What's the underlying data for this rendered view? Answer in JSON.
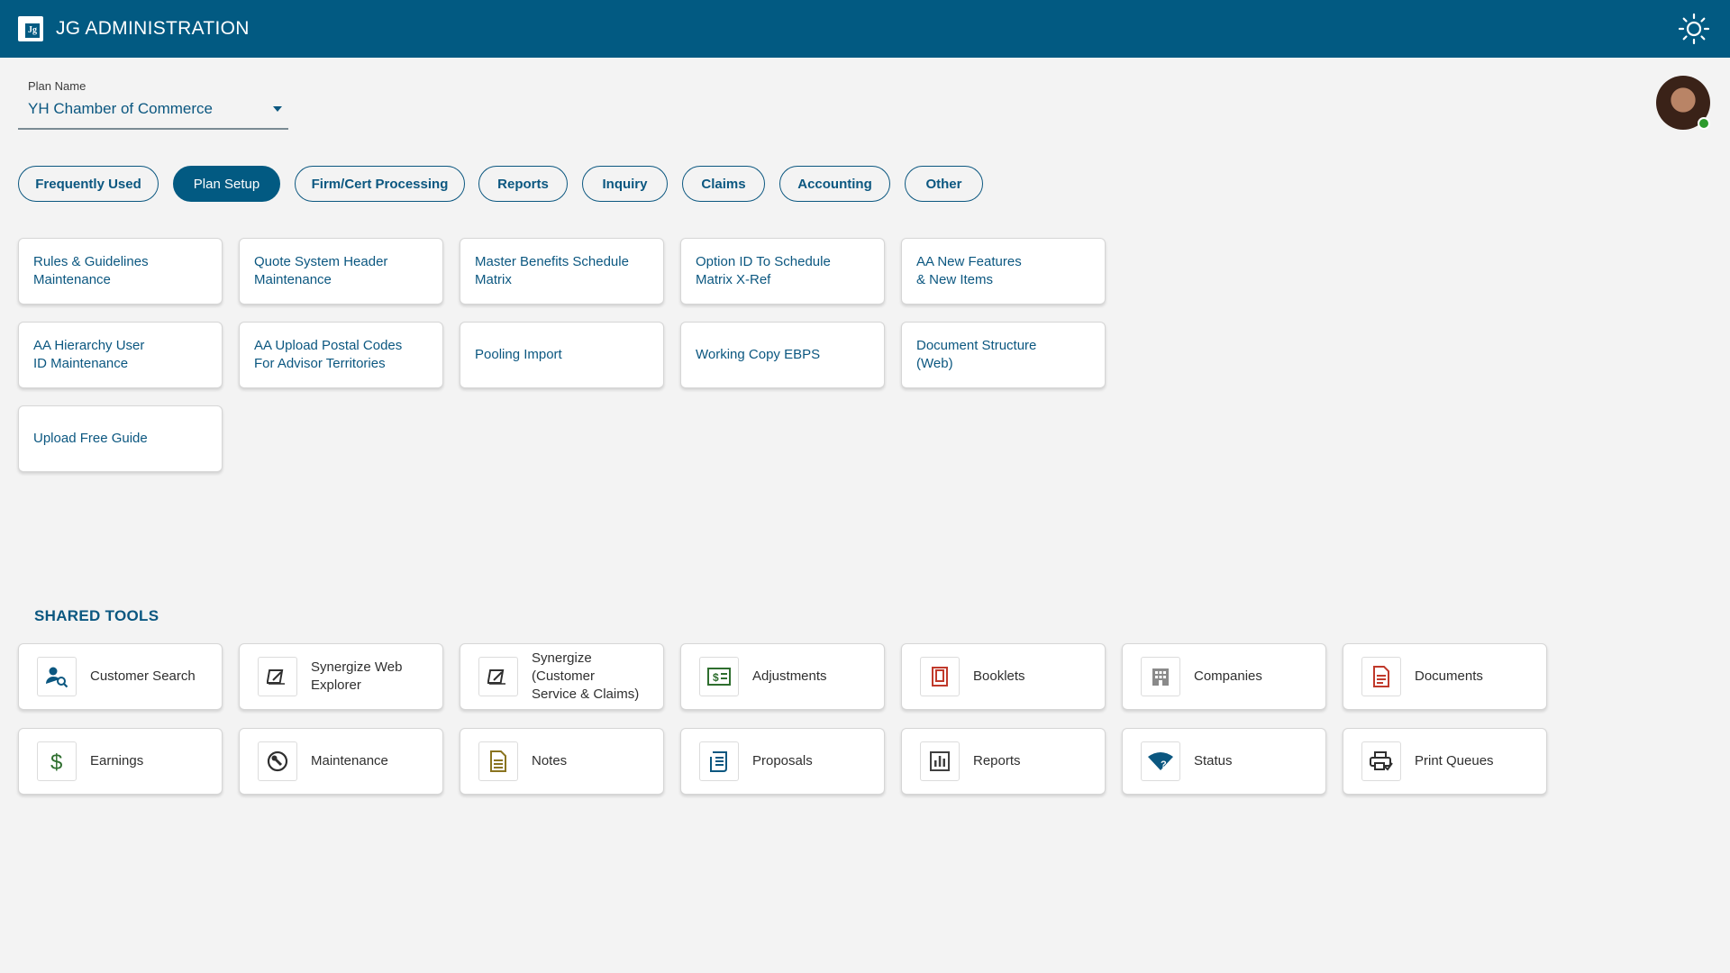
{
  "header": {
    "app_title": "JG ADMINISTRATION",
    "logo_text": "Jg",
    "brand_color": "#025a82",
    "theme_icon": "sun-icon"
  },
  "plan": {
    "label": "Plan Name",
    "value": "YH Chamber of Commerce"
  },
  "user": {
    "status": "online",
    "status_color": "#2e9b2e"
  },
  "tabs": [
    {
      "label": "Frequently Used",
      "active": false
    },
    {
      "label": "Plan Setup",
      "active": true
    },
    {
      "label": "Firm/Cert Processing",
      "active": false
    },
    {
      "label": "Reports",
      "active": false
    },
    {
      "label": "Inquiry",
      "active": false
    },
    {
      "label": "Claims",
      "active": false
    },
    {
      "label": "Accounting",
      "active": false
    },
    {
      "label": "Other",
      "active": false
    }
  ],
  "plan_setup_items": [
    {
      "label": "Rules & Guidelines\nMaintenance"
    },
    {
      "label": "Quote System Header\nMaintenance"
    },
    {
      "label": "Master Benefits Schedule\nMatrix"
    },
    {
      "label": "Option ID To Schedule\nMatrix X-Ref"
    },
    {
      "label": "AA New Features\n& New Items"
    },
    {
      "label": "AA Hierarchy User\nID Maintenance"
    },
    {
      "label": "AA Upload Postal Codes\nFor Advisor Territories"
    },
    {
      "label": "Pooling Import"
    },
    {
      "label": "Working Copy EBPS"
    },
    {
      "label": "Document Structure\n(Web)"
    },
    {
      "label": "Upload Free Guide"
    }
  ],
  "shared_tools": {
    "title": "SHARED TOOLS",
    "items": [
      {
        "label": "Customer Search",
        "icon": "customer-search-icon",
        "color": "#0b5780"
      },
      {
        "label": "Synergize Web\nExplorer",
        "icon": "synergize-icon",
        "color": "#2f2f2f"
      },
      {
        "label": "Synergize (Customer\nService & Claims)",
        "icon": "synergize-icon",
        "color": "#2f2f2f"
      },
      {
        "label": "Adjustments",
        "icon": "adjustments-icon",
        "color": "#2e6e2e"
      },
      {
        "label": "Booklets",
        "icon": "booklet-icon",
        "color": "#c0392b"
      },
      {
        "label": "Companies",
        "icon": "building-icon",
        "color": "#8a8a8a"
      },
      {
        "label": "Documents",
        "icon": "document-icon",
        "color": "#c0392b"
      },
      {
        "label": "Earnings",
        "icon": "dollar-icon",
        "color": "#2e6e2e"
      },
      {
        "label": "Maintenance",
        "icon": "wrench-icon",
        "color": "#2f2f2f"
      },
      {
        "label": "Notes",
        "icon": "notes-icon",
        "color": "#8a7420"
      },
      {
        "label": "Proposals",
        "icon": "proposal-icon",
        "color": "#0b5780"
      },
      {
        "label": "Reports",
        "icon": "bar-chart-icon",
        "color": "#3f3f3f"
      },
      {
        "label": "Status",
        "icon": "status-icon",
        "color": "#0b5780"
      },
      {
        "label": "Print Queues",
        "icon": "print-icon",
        "color": "#2f2f2f"
      }
    ]
  }
}
